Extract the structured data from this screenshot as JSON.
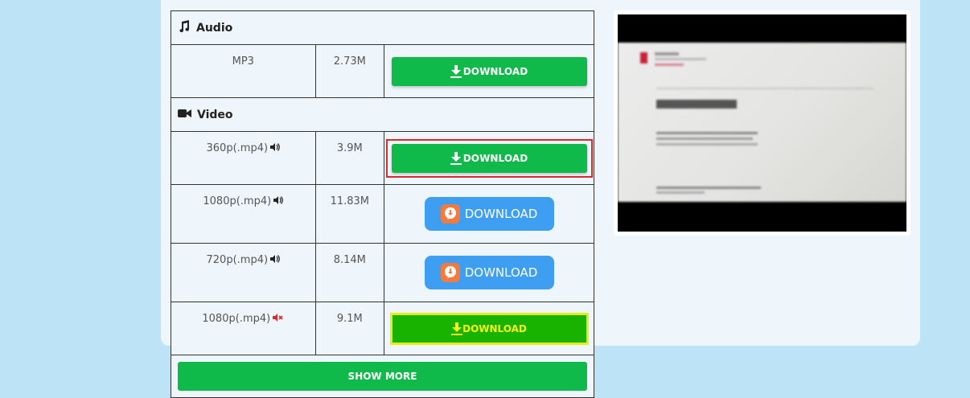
{
  "audio": {
    "title": "Audio",
    "rows": [
      {
        "quality": "MP3",
        "size": "2.73M",
        "button": "DOWNLOAD"
      }
    ]
  },
  "video": {
    "title": "Video",
    "rows": [
      {
        "quality": "360p(.mp4)",
        "audio": true,
        "size": "3.9M",
        "button": "DOWNLOAD",
        "style": "green-highlighted"
      },
      {
        "quality": "1080p(.mp4)",
        "audio": true,
        "size": "11.83M",
        "button": "DOWNLOAD",
        "style": "blue-app"
      },
      {
        "quality": "720p(.mp4)",
        "audio": true,
        "size": "8.14M",
        "button": "DOWNLOAD",
        "style": "blue-app"
      },
      {
        "quality": "1080p(.mp4)",
        "audio": false,
        "size": "9.1M",
        "button": "DOWNLOAD",
        "style": "yellow-highlighted"
      }
    ]
  },
  "show_more": "SHOW MORE",
  "preview": {
    "slide_logo_text": "",
    "slide_title": "",
    "caption_line1": "",
    "caption_line2": "",
    "caption_line3": ""
  },
  "colors": {
    "green": "#0fba4a",
    "blue": "#3e9ef1",
    "highlight_red": "#d92b2b",
    "highlight_yellow": "#e8ea1a",
    "background": "#bde3f7"
  },
  "icons": {
    "audio_section": "music-note-icon",
    "video_section": "video-camera-icon",
    "download": "download-arrow-icon",
    "speaker_on": "speaker-icon",
    "speaker_muted": "speaker-muted-icon",
    "app": "app-download-icon"
  }
}
